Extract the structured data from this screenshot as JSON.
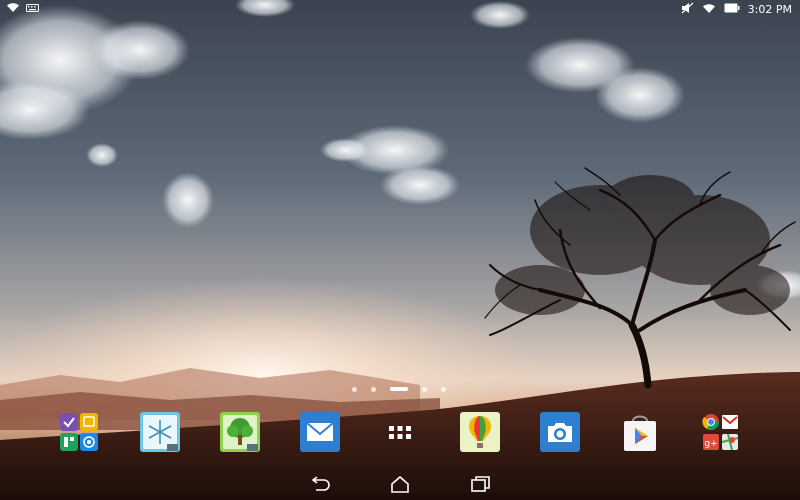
{
  "status_bar": {
    "time": "3:02 PM",
    "left_icons": [
      "wifi-icon",
      "keyboard-notification-icon"
    ],
    "right_icons": [
      "mute-icon",
      "wifi-icon",
      "battery-icon"
    ]
  },
  "home_screen": {
    "page_count": 5,
    "active_page": 3
  },
  "dock": {
    "items": [
      {
        "name": "app-folder",
        "icon": "app-folder-icon"
      },
      {
        "name": "weather-widget-app",
        "icon": "snowflake-icon"
      },
      {
        "name": "file-manager-app",
        "icon": "tree-icon"
      },
      {
        "name": "email-app",
        "icon": "envelope-icon"
      },
      {
        "name": "all-apps-button",
        "icon": "app-drawer-icon"
      },
      {
        "name": "balloon-app",
        "icon": "hot-air-balloon-icon"
      },
      {
        "name": "camera-app",
        "icon": "camera-icon"
      },
      {
        "name": "play-store-app",
        "icon": "play-store-icon"
      },
      {
        "name": "google-folder",
        "icon": "google-folder-icon"
      }
    ]
  },
  "nav_bar": {
    "buttons": [
      "back-icon",
      "home-icon",
      "recent-apps-icon"
    ]
  },
  "colors": {
    "email": "#2f7fd1",
    "camera": "#2f7fd1",
    "file_manager": "#8fd14f",
    "weather": "#6cc6e8",
    "folder_purple": "#7a4fb0"
  }
}
